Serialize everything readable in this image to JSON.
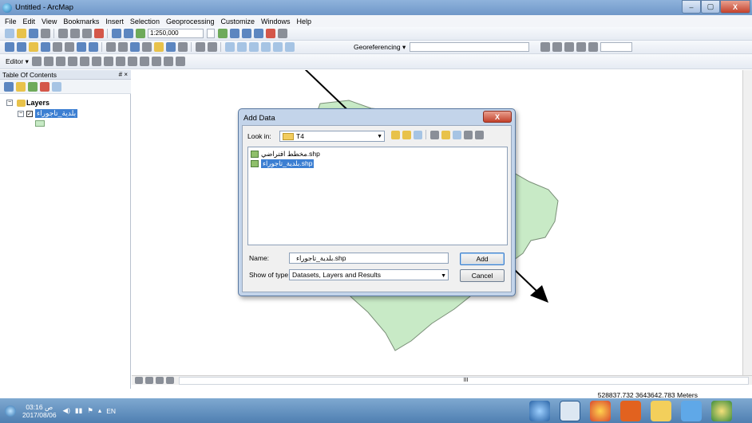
{
  "window": {
    "title": "Untitled - ArcMap",
    "min": "–",
    "max": "▢",
    "close": "X"
  },
  "menu": [
    "File",
    "Edit",
    "View",
    "Bookmarks",
    "Insert",
    "Selection",
    "Geoprocessing",
    "Customize",
    "Windows",
    "Help"
  ],
  "toolbar": {
    "scale": "1:250,000",
    "georef_label": "Georeferencing ▾",
    "editor_label": "Editor ▾"
  },
  "toc": {
    "title": "Table Of Contents",
    "pin": "# ×",
    "layers_label": "Layers",
    "layer_name": "بلدية_تاجوراء",
    "expander": "−",
    "check": "✓"
  },
  "map": {
    "polygon_fill": "#c8eac6",
    "polygon_stroke": "#7a8f78"
  },
  "status": {
    "coords": "528837.732  3643642.783 Meters"
  },
  "scroll": {
    "h_mark": "III"
  },
  "dialog": {
    "title": "Add Data",
    "close": "X",
    "look_in_label": "Look in:",
    "look_in_value": "T4",
    "files": [
      {
        "name": "مخطط افتراضي.shp",
        "selected": false
      },
      {
        "name": "بلدية_تاجوراء.shp",
        "selected": true
      }
    ],
    "name_label": "Name:",
    "name_value": "بلدية_تاجوراء.shp",
    "type_label": "Show of type:",
    "type_value": "Datasets, Layers and Results",
    "add_label": "Add",
    "cancel_label": "Cancel"
  },
  "taskbar": {
    "time": "03:16 ص",
    "date": "2017/08/06",
    "lang": "EN"
  }
}
